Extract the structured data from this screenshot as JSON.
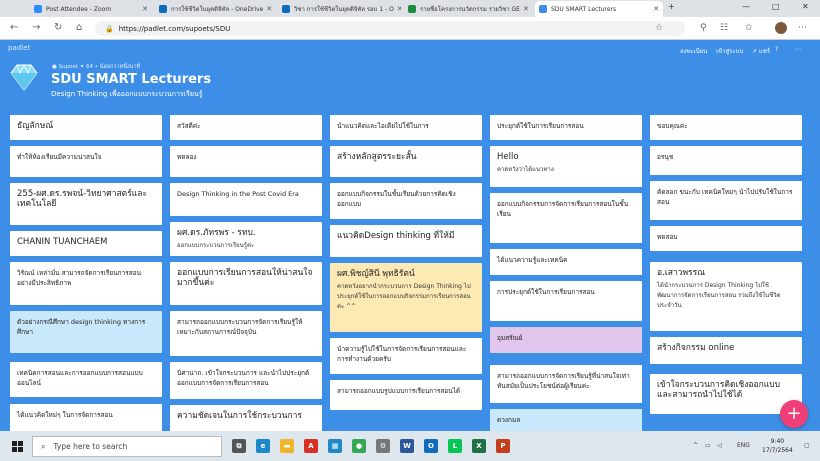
{
  "browser": {
    "tabs": [
      {
        "label": "Post Attendee - Zoom",
        "icon_color": "#2d8cff",
        "active": false
      },
      {
        "label": "การใช้ชีวิตในยุคดิจิทัล - OneDrive",
        "icon_color": "#0f6cbd",
        "active": false
      },
      {
        "label": "วิชา การใช้ชีวิตในยุคดิจิทัล รอบ 1 - O",
        "icon_color": "#0f6cbd",
        "active": false
      },
      {
        "label": "รายชื่อโครงการนวัตกรรม รายวิชา GE",
        "icon_color": "#1e8e3e",
        "active": false
      },
      {
        "label": "SDU SMART Lecturers",
        "icon_color": "#3d8ee6",
        "active": true
      }
    ],
    "url": "https://padlet.com/supoets/SDU",
    "window_controls": [
      "—",
      "□",
      "✕"
    ]
  },
  "padlet": {
    "logo": "padlet",
    "author_name": "Supoet",
    "karma": "64",
    "time_ago": "น้อยกว่าหนึ่งนาที",
    "title": "SDU SMART Lecturers",
    "subtitle": "Design Thinking เพื่อออกแบบกระบวนการเรียนรู้",
    "header_actions": [
      "ลงทะเบียน",
      "เข้าสู่ระบบ",
      "↗ แชร์",
      "?",
      "⋯"
    ]
  },
  "columns": [
    {
      "posts": [
        {
          "title": "ธัญลักษณ์",
          "body": "",
          "color": "#ffffff",
          "big": true
        },
        {
          "title": "ทำให้ห้องเรียนมีความน่าสนใจ",
          "body": "",
          "color": "#ffffff"
        },
        {
          "title": "255-ผศ.ดร.รพจน์-วิทยาศาสตร์และเทคโนโลยี",
          "body": "",
          "color": "#ffffff",
          "big": true
        },
        {
          "title": "CHANIN TUANCHAEM",
          "body": "",
          "color": "#ffffff",
          "big": true
        },
        {
          "title": "วิรัณน์ เหล่ามั่น  สามารถจัดการเรียนการสอนอย่างมีประสิทธิภาพ",
          "body": "",
          "color": "#ffffff"
        },
        {
          "title": "ตัวอย่างกรณีศึกษา design thinking ทางการศึกษา",
          "body": "",
          "color": "#c9e8fb"
        },
        {
          "title": "เทคนิคการสอนและการออกแบบการสอนแบบออนไลน์",
          "body": "",
          "color": "#ffffff"
        },
        {
          "title": "ได้แนวคิดใหม่ๆ ในการจัดการสอน",
          "body": "",
          "color": "#ffffff"
        }
      ]
    },
    {
      "posts": [
        {
          "title": "สวัสดีค่ะ",
          "body": "",
          "color": "#ffffff"
        },
        {
          "title": "ทดลอง",
          "body": "",
          "color": "#ffffff"
        },
        {
          "title": "Design Thinking in the Post Covid Era",
          "body": "",
          "color": "#ffffff"
        },
        {
          "title": "ผศ.ดร.ภัทรพร - รทบ.",
          "body": "ออกแบบกระบวนการเรียนรู้ค่ะ",
          "color": "#ffffff",
          "big": true
        },
        {
          "title": "ออกแบบการเรียนการสอนให้น่าสนใจมากขึ้นค่ะ",
          "body": "",
          "color": "#ffffff",
          "big": true
        },
        {
          "title": "สามารถออกแบบกระบวนการจัดการเรียนรู้ให้เหมาะกับสถานการณ์ปัจจุบัน",
          "body": "",
          "color": "#ffffff"
        },
        {
          "title": "นิศานาถ. เข้าใจกระบวนการ และนำไปประยุกต์ออกแบบการจัดการเรียนการสอน",
          "body": "",
          "color": "#ffffff"
        },
        {
          "title": "ความชัดเจนในการใช้กระบวนการ",
          "body": "",
          "color": "#ffffff",
          "big": true
        }
      ]
    },
    {
      "posts": [
        {
          "title": "นำแนวคิดและไอเดียไปใช้ในการ",
          "body": "",
          "color": "#ffffff"
        },
        {
          "title": "สร้างหลักสูตรระยะสั้น",
          "body": "",
          "color": "#ffffff",
          "big": true
        },
        {
          "title": "ออกแบบกิจกรรมในชั้นเรียนด้วยการคิดเชิงออกแบบ",
          "body": "",
          "color": "#ffffff"
        },
        {
          "title": "แนวคิดDesign thinking ที่ให้มี",
          "body": "",
          "color": "#ffffff",
          "big": true
        },
        {
          "title": "ผศ.พิชญ์สินี พุทธิรัตน์",
          "body": "คาดหวังอยากนำกระบวนการ Design Thinking ไปประยุกต์ใช้ในการออกแบบกิจกรรมการเรียนการสอนค่ะ ^^",
          "color": "#fde9b4",
          "big": true
        },
        {
          "title": "นำความรู้ไปใช้ในการจัดการเรียนการสอนและการทำงานด้วยครับ",
          "body": "",
          "color": "#ffffff"
        },
        {
          "title": "สามารถออกแบบรูปแบบการเรียนการสอนได้",
          "body": "",
          "color": "#ffffff"
        }
      ]
    },
    {
      "posts": [
        {
          "title": "ประยุกต์ใช้ในการเรียนการสอน",
          "body": "",
          "color": "#ffffff"
        },
        {
          "title": "Hello",
          "body": "คาดหวังว่าได้แนวทาง",
          "color": "#ffffff",
          "big": true
        },
        {
          "title": "ออกแบบกิจกรรมการจัดการเรียนการสอนในชั้นเรียน",
          "body": "",
          "color": "#ffffff"
        },
        {
          "title": "ได้แนวความรู้และเทคนิค",
          "body": "",
          "color": "#ffffff"
        },
        {
          "title": "การประยุกต์ใช้ในการเรียนการสอน",
          "body": "",
          "color": "#ffffff"
        },
        {
          "title": "อุมสรัณย์",
          "body": "",
          "color": "#e1c7ee"
        },
        {
          "title": "สามารถออกแบบการจัดการเรียนรู้ที่น่าสนใจเท่าทันสมัยเป็นประโยชน์ต่อผู้เรียนค่ะ",
          "body": "",
          "color": "#ffffff"
        },
        {
          "title": "ดวงกมล",
          "body": "",
          "color": "#c9e8fb"
        }
      ]
    },
    {
      "posts": [
        {
          "title": "ขอบคุณค่ะ",
          "body": "",
          "color": "#ffffff"
        },
        {
          "title": "อรนุช",
          "body": "",
          "color": "#ffffff"
        },
        {
          "title": "คัดลอก ขนะกับ เทคนิคใหม่ๆ นำไปปรับใช้ในการสอน",
          "body": "",
          "color": "#ffffff"
        },
        {
          "title": "ทดสอบ",
          "body": "",
          "color": "#ffffff"
        },
        {
          "title": "อ.เสาวพรรณ",
          "body": "ได้นำกระบวนการ Design Thinking ไปใช้พัฒนาการจัดการเรียนการสอน รวมถึงใช้ในชีวิตประจำวัน",
          "color": "#ffffff",
          "big": true
        },
        {
          "title": "สร้างกิจกรรม online",
          "body": "",
          "color": "#ffffff",
          "big": true
        },
        {
          "title": "เข้าใจกระบวนการคิดเชิงออกแบบ และสามารถนำไปใช้ได้",
          "body": "",
          "color": "#ffffff",
          "big": true
        }
      ]
    }
  ],
  "fab": {
    "label": "+"
  },
  "taskbar": {
    "search_placeholder": "Type here to search",
    "apps": [
      {
        "name": "task-view",
        "glyph": "⧉",
        "color": "#555555"
      },
      {
        "name": "edge",
        "glyph": "e",
        "color": "#1e88c8"
      },
      {
        "name": "file-explorer",
        "glyph": "▬",
        "color": "#f0b429"
      },
      {
        "name": "acrobat",
        "glyph": "A",
        "color": "#d93025"
      },
      {
        "name": "store",
        "glyph": "▦",
        "color": "#1e88c8"
      },
      {
        "name": "chrome",
        "glyph": "●",
        "color": "#34a853"
      },
      {
        "name": "settings",
        "glyph": "⚙",
        "color": "#777777"
      },
      {
        "name": "word",
        "glyph": "W",
        "color": "#2b579a"
      },
      {
        "name": "outlook",
        "glyph": "O",
        "color": "#0f6cbd"
      },
      {
        "name": "line",
        "glyph": "L",
        "color": "#06c755"
      },
      {
        "name": "excel",
        "glyph": "X",
        "color": "#1e7145"
      },
      {
        "name": "powerpoint",
        "glyph": "P",
        "color": "#c43e1c"
      }
    ],
    "language": "ENG",
    "time": "9:40",
    "date": "17/7/2564"
  }
}
